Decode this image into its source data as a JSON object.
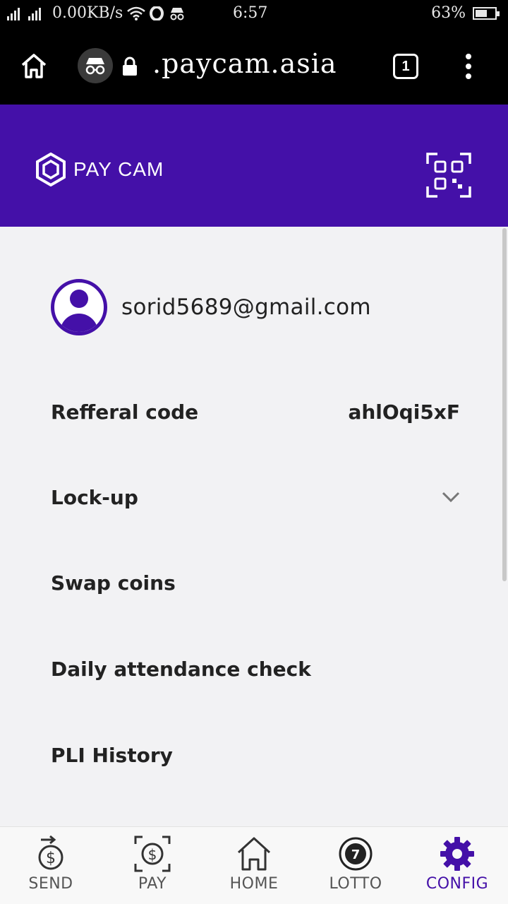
{
  "status_bar": {
    "network_speed": "0.00KB/s",
    "time": "6:57",
    "battery_level": "63%",
    "battery_fraction": 0.63
  },
  "browser": {
    "url": ".paycam.asia",
    "tab_count": "1"
  },
  "header": {
    "brand": "PAY CAM",
    "qr_icon": "qr-scan-icon"
  },
  "profile": {
    "email": "sorid5689@gmail.com"
  },
  "menu": {
    "referral_label": "Refferal code",
    "referral_value": "ahlOqi5xF",
    "lockup_label": "Lock-up",
    "swap_label": "Swap coins",
    "attendance_label": "Daily attendance check",
    "pli_label": "PLI History"
  },
  "nav": {
    "send": "SEND",
    "pay": "PAY",
    "home": "HOME",
    "lotto": "LOTTO",
    "lotto_badge": "7",
    "config": "CONFIG"
  },
  "colors": {
    "accent": "#4410a8",
    "header_bg": "#4410a8",
    "nav_inactive": "#555555"
  }
}
